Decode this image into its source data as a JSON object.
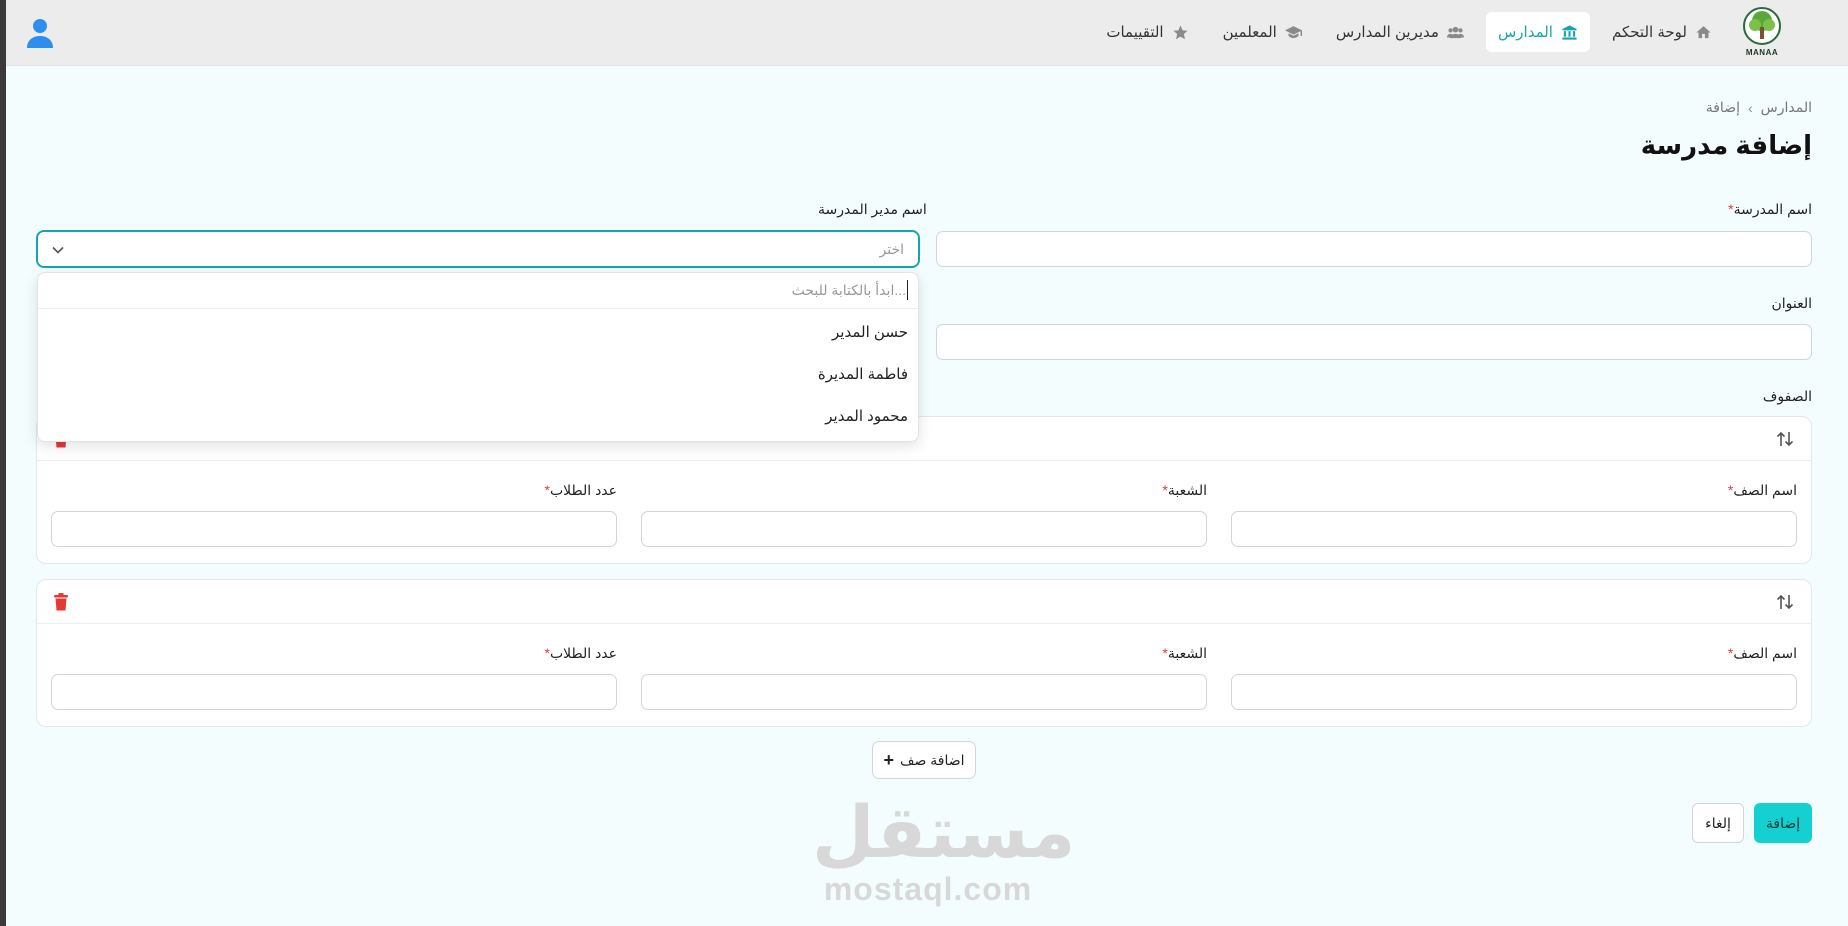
{
  "nav": {
    "logo_text": "MANAA",
    "items": [
      {
        "label": "لوحة التحكم",
        "icon": "home-icon"
      },
      {
        "label": "المدارس",
        "icon": "bank-icon"
      },
      {
        "label": "مديرين المدارس",
        "icon": "users-icon"
      },
      {
        "label": "المعلمين",
        "icon": "graduation-cap-icon"
      },
      {
        "label": "التقييمات",
        "icon": "star-icon"
      }
    ],
    "active_index": 1
  },
  "breadcrumb": [
    "المدارس",
    "إضافة"
  ],
  "page_title": "إضافة مدرسة",
  "form": {
    "school_name": {
      "label": "اسم المدرسة",
      "required": "*",
      "value": ""
    },
    "principal": {
      "label": "اسم مدير المدرسة",
      "placeholder": "اختر"
    },
    "address": {
      "label": "العنوان",
      "value": ""
    },
    "classes_label": "الصفوف",
    "row_fields": {
      "class_name": "اسم الصف",
      "section": "الشعبة",
      "students": "عدد الطلاب",
      "required": "*"
    }
  },
  "dropdown": {
    "search_placeholder": "ابدأ بالكتابة للبحث...",
    "options": [
      "حسن المدير",
      "فاطمة المديرة",
      "محمود المدير"
    ]
  },
  "actions": {
    "add_row": "اضافة صف",
    "add_row_icon": "+",
    "submit": "إضافة",
    "cancel": "إلغاء"
  },
  "watermark": {
    "arabic": "مستقل",
    "latin": "mostaql.com"
  },
  "colors": {
    "accent": "#16a5b0",
    "primary_button": "#14d0d0",
    "danger": "#e53935"
  }
}
